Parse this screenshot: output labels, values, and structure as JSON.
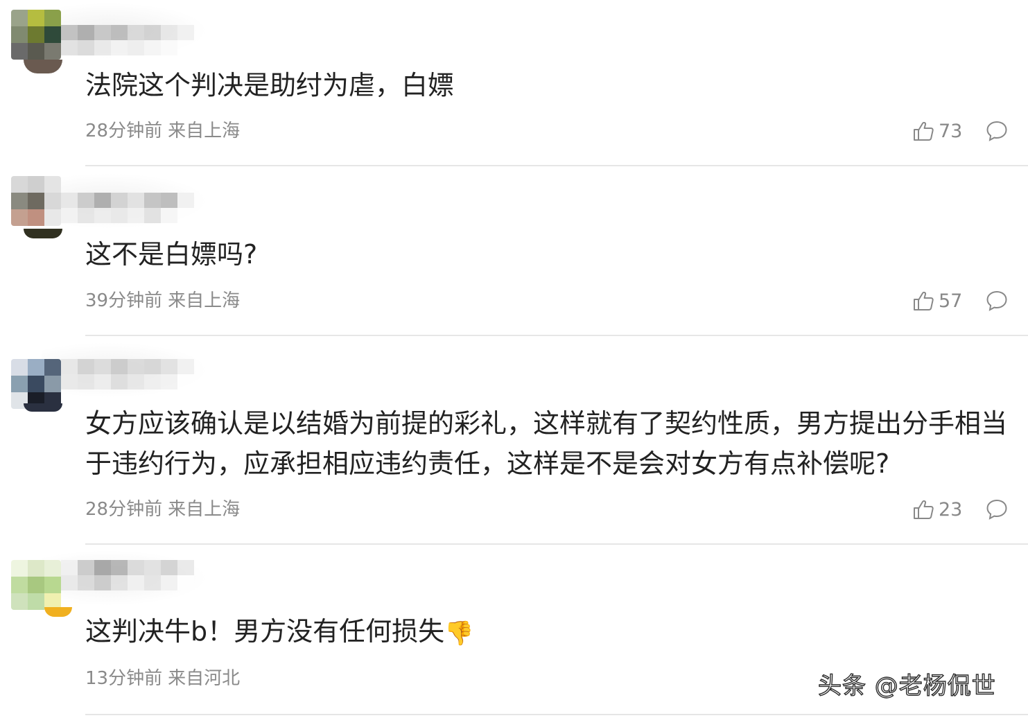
{
  "comments": [
    {
      "text": "法院这个判决是助纣为虐，白嫖",
      "time": "28分钟前",
      "location": "来自上海",
      "likes": "73",
      "avatar_colors": [
        "#9aa38a",
        "#b5bd40",
        "#8aa04a",
        "#808a70",
        "#6d7a30",
        "#2f4a3a",
        "#6a6a6a",
        "#5a5a50",
        "#7a7a70"
      ],
      "name_colors": [
        "#bdbdbd",
        "#a8a8a8",
        "#c4c4c4",
        "#b8b8b8",
        "#d6d6d6",
        "#cfcfcf",
        "#e6e6e6",
        "#f0f0f0",
        "#e0e0e0",
        "#d8d8d8",
        "#e8e8e8",
        "#f2f2f2",
        "#ededed",
        "#f5f5f5",
        "#fafafa",
        "#ffffff"
      ]
    },
    {
      "text": "这不是白嫖吗?",
      "time": "39分钟前",
      "location": "来自上海",
      "likes": "57",
      "avatar_colors": [
        "#d8d8d8",
        "#cfcfcf",
        "#e4e4e4",
        "#8a8a80",
        "#6e6a60",
        "#d8d8d8",
        "#c4a090",
        "#c09080",
        "#e8e8e8"
      ],
      "name_colors": [
        "#e6e6e6",
        "#c8c8c8",
        "#a8a8a8",
        "#d0d0d0",
        "#e0e0e0",
        "#c0c0c0",
        "#b8b8b8",
        "#f0f0f0",
        "#f2f2f2",
        "#e4e4e4",
        "#ececec",
        "#e8e8e8",
        "#f0f0f0",
        "#e0e0e0",
        "#f6f6f6",
        "#ffffff"
      ]
    },
    {
      "text": "女方应该确认是以结婚为前提的彩礼，这样就有了契约性质，男方提出分手相当于违约行为，应承担相应违约责任，这样是不是会对女方有点补偿呢?",
      "time": "28分钟前",
      "location": "来自上海",
      "likes": "23",
      "avatar_colors": [
        "#d8dde6",
        "#9aaec4",
        "#55657a",
        "#8aa0b0",
        "#3a4a60",
        "#8a9aa8",
        "#e0e4e8",
        "#1a1e28",
        "#2a3040"
      ],
      "name_colors": [
        "#e6e6e6",
        "#d0d0d0",
        "#dadada",
        "#c8c8c8",
        "#d8d8d8",
        "#d4d4d4",
        "#e0e0e0",
        "#f0f0f0",
        "#e8e8e8",
        "#e4e4e4",
        "#ececec",
        "#dcdcdc",
        "#e6e6e6",
        "#eeeeee",
        "#f2f2f2",
        "#ffffff"
      ]
    },
    {
      "text": "这判决牛b！男方没有任何损失",
      "time": "13分钟前",
      "location": "来自河北",
      "likes": "",
      "avatar_colors": [
        "#eef5e0",
        "#dde8c8",
        "#e8f0d8",
        "#c0dca0",
        "#a8c880",
        "#b8d890",
        "#cfe2bc",
        "#bfdca8",
        "#f0f0b0"
      ],
      "name_colors": [
        "#f0f0f0",
        "#c8c8c8",
        "#a0a0a0",
        "#b0b0b0",
        "#d8d8d8",
        "#e0e0e0",
        "#d0d0d0",
        "#e8e8e8",
        "#e8e8e8",
        "#d8d8d8",
        "#c8c8c8",
        "#e0e0e0",
        "#f0f0f0",
        "#e4e4e4",
        "#f2f2f2",
        "#ffffff"
      ]
    }
  ],
  "watermark": "头条 @老杨侃世",
  "emoji": "👎"
}
